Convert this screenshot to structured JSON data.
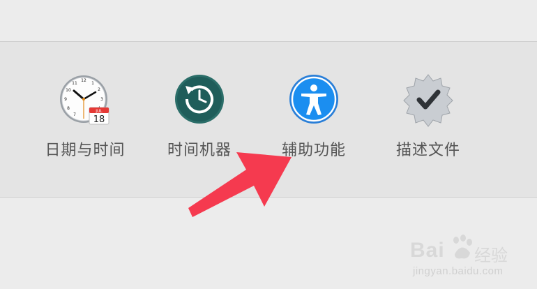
{
  "prefs_row": {
    "items": [
      {
        "label": "日期与时间",
        "icon": "date-time-clock-icon",
        "calendar_month": "JUL",
        "calendar_day": "18"
      },
      {
        "label": "时间机器",
        "icon": "time-machine-icon"
      },
      {
        "label": "辅助功能",
        "icon": "accessibility-icon"
      },
      {
        "label": "描述文件",
        "icon": "profiles-badge-checkmark-icon"
      }
    ]
  },
  "annotation": {
    "arrow_color": "#f53a4f",
    "points_to": "辅助功能"
  },
  "watermark": {
    "brand": "Bai",
    "brand_cn": "经验",
    "url": "jingyan.baidu.com"
  },
  "colors": {
    "time_machine": "#1f5d5a",
    "accessibility": "#1b8ef0",
    "badge": "#c9cdd2"
  }
}
